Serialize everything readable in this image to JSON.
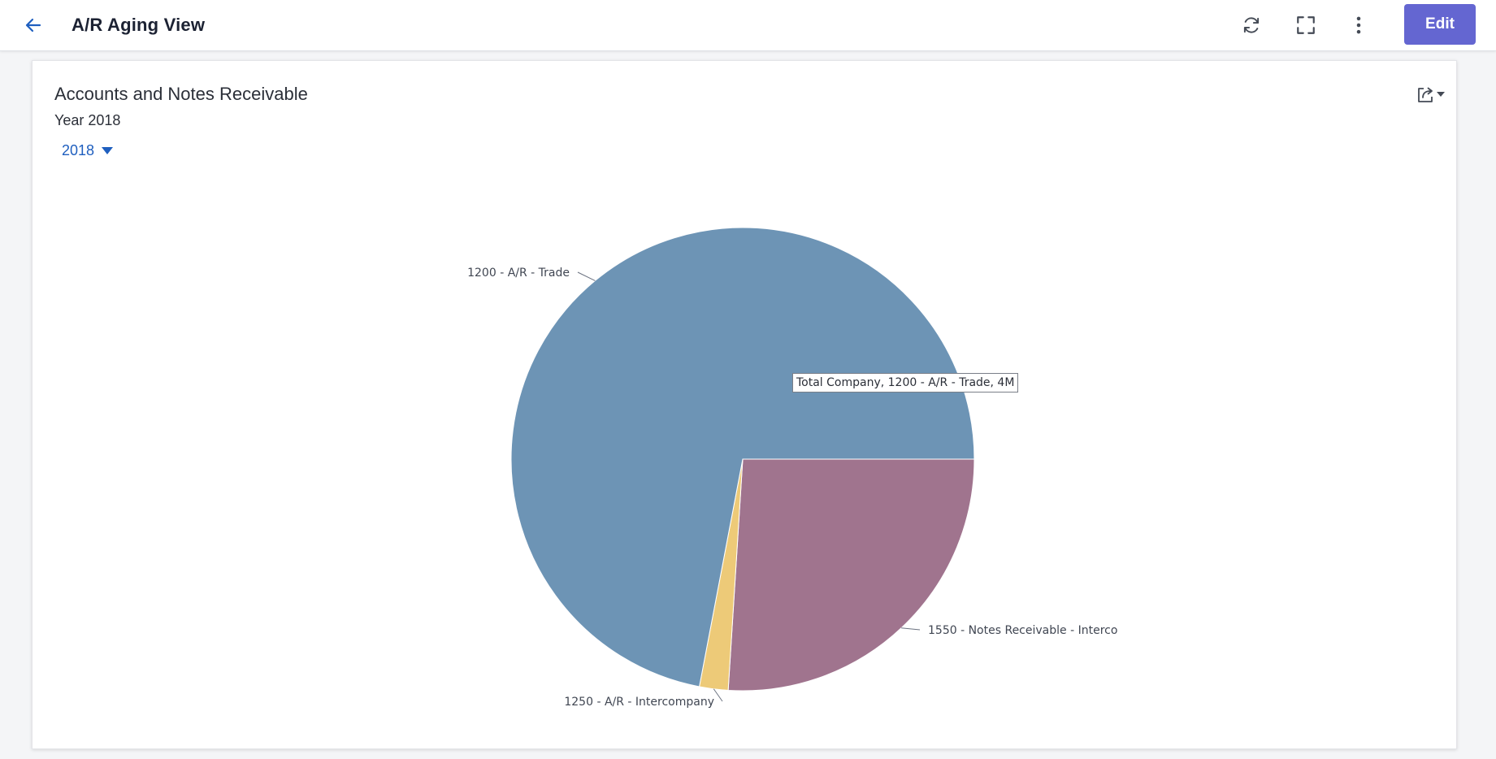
{
  "header": {
    "title": "A/R Aging View",
    "edit_label": "Edit",
    "icons": [
      "back-arrow-icon",
      "refresh-icon",
      "fullscreen-icon",
      "more-vertical-icon"
    ]
  },
  "card": {
    "title": "Accounts and Notes Receivable",
    "subtitle": "Year 2018",
    "year_filter": {
      "selected": "2018",
      "icon": "caret-down-icon"
    },
    "export_icon": "export-icon"
  },
  "tooltip": {
    "text": "Total Company, 1200 - A/R - Trade, 4M"
  },
  "chart_data": {
    "type": "pie",
    "title": "",
    "slices": [
      {
        "label": "1200 - A/R - Trade",
        "value": 72.0,
        "color": "#6d94b5"
      },
      {
        "label": "1550 - Notes Receivable - Interco",
        "value": 26.0,
        "color": "#a0748e"
      },
      {
        "label": "1250 - A/R - Intercompany",
        "value": 2.0,
        "color": "#edca78"
      }
    ],
    "start": "3 o'clock, clockwise (1550 first)",
    "legend": "none (slice labels outside)"
  }
}
